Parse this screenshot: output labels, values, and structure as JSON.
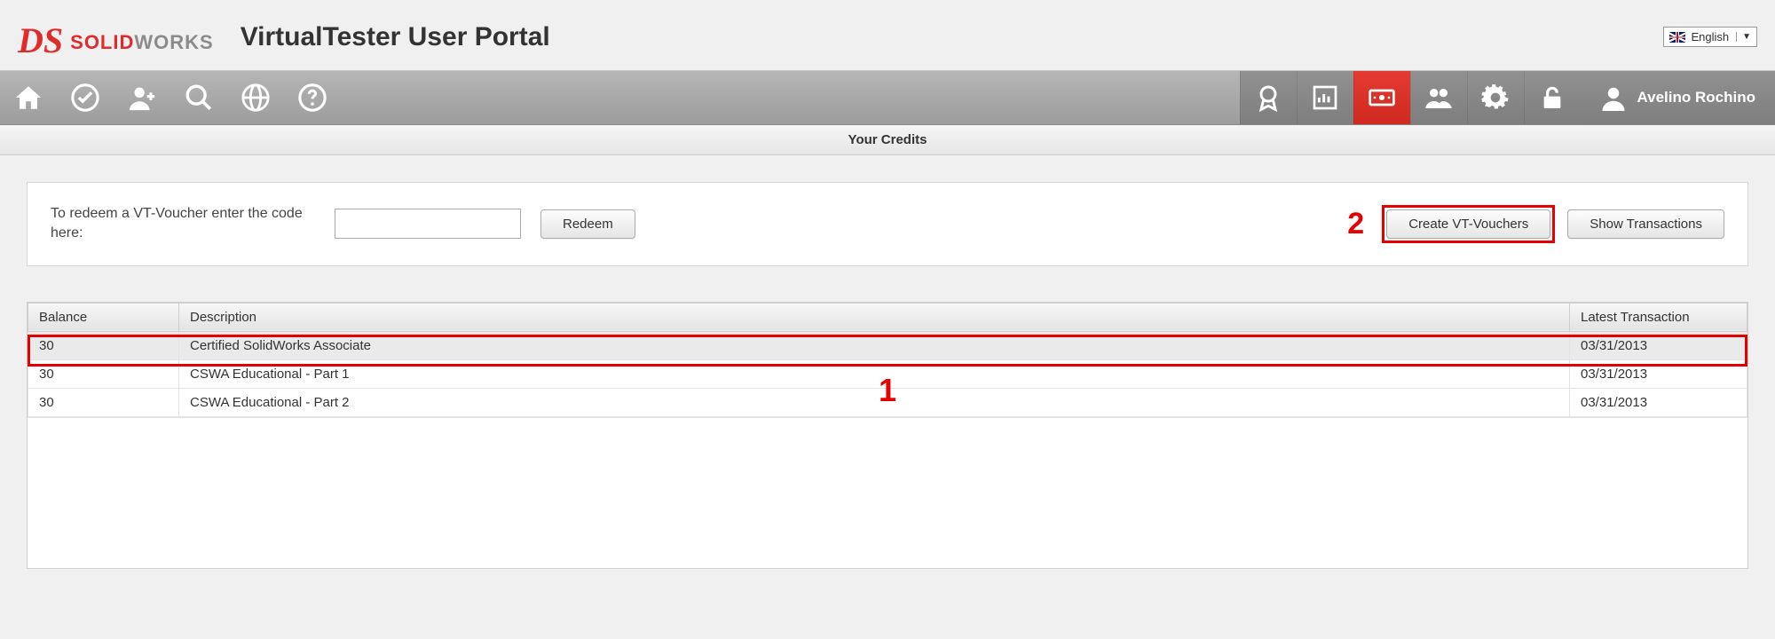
{
  "header": {
    "brand_solid": "SOLID",
    "brand_works": "WORKS",
    "portal_title": "VirtualTester User Portal",
    "language_label": "English"
  },
  "nav": {
    "left_icons": [
      "home-icon",
      "check-icon",
      "add-user-icon",
      "search-icon",
      "globe-icon",
      "help-icon"
    ],
    "right_icons": [
      "badge-icon",
      "stats-icon",
      "credits-icon",
      "users-icon",
      "gear-icon",
      "unlock-icon"
    ],
    "active_right_index": 2
  },
  "user": {
    "display_name": "Avelino Rochino"
  },
  "subheader": {
    "title": "Your Credits"
  },
  "redeem": {
    "label": "To redeem a VT-Voucher enter the code here:",
    "input_value": "",
    "redeem_button": "Redeem",
    "create_button": "Create VT-Vouchers",
    "transactions_button": "Show Transactions"
  },
  "annotations": {
    "step1": "1",
    "step2": "2"
  },
  "table": {
    "columns": {
      "balance": "Balance",
      "description": "Description",
      "latest": "Latest Transaction"
    },
    "rows": [
      {
        "balance": "30",
        "description": "Certified SolidWorks Associate",
        "latest": "03/31/2013"
      },
      {
        "balance": "30",
        "description": "CSWA Educational - Part 1",
        "latest": "03/31/2013"
      },
      {
        "balance": "30",
        "description": "CSWA Educational - Part 2",
        "latest": "03/31/2013"
      }
    ]
  }
}
